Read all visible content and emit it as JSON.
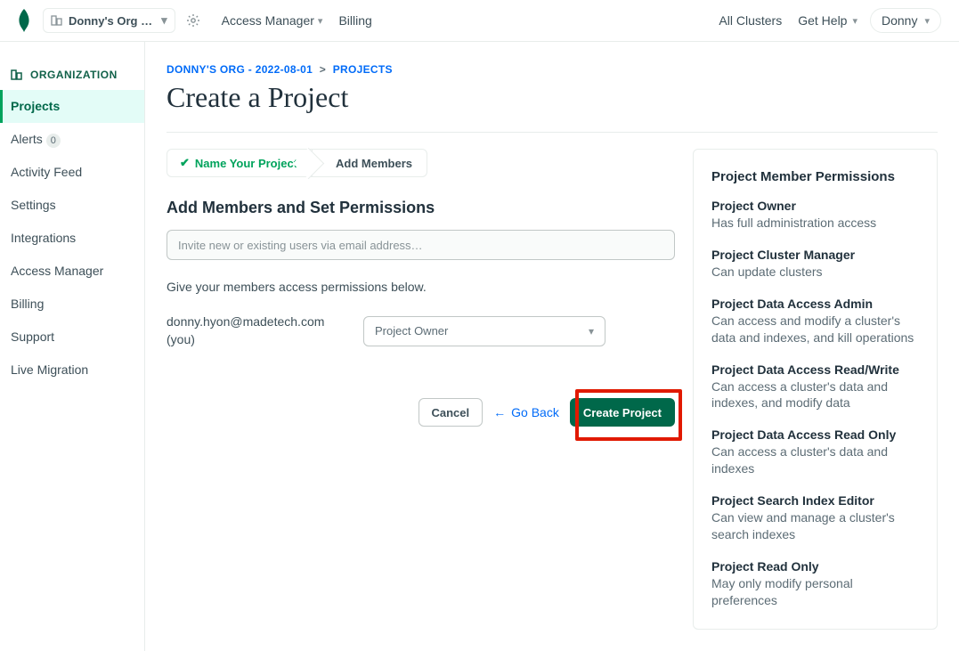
{
  "header": {
    "org_name": "Donny's Org …",
    "access_manager": "Access Manager",
    "billing": "Billing",
    "all_clusters": "All Clusters",
    "get_help": "Get Help",
    "user": "Donny"
  },
  "sidebar": {
    "heading": "ORGANIZATION",
    "items": [
      {
        "label": "Projects",
        "active": true
      },
      {
        "label": "Alerts",
        "badge": "0"
      },
      {
        "label": "Activity Feed"
      },
      {
        "label": "Settings"
      },
      {
        "label": "Integrations"
      },
      {
        "label": "Access Manager"
      },
      {
        "label": "Billing"
      },
      {
        "label": "Support"
      },
      {
        "label": "Live Migration"
      }
    ]
  },
  "breadcrumb": {
    "org": "DONNY'S ORG - 2022-08-01",
    "page": "PROJECTS"
  },
  "page_title": "Create a Project",
  "steps": {
    "step1": "Name Your Project",
    "step2": "Add Members"
  },
  "form": {
    "section_title": "Add Members and Set Permissions",
    "invite_placeholder": "Invite new or existing users via email address…",
    "hint": "Give your members access permissions below.",
    "member_email": "donny.hyon@madetech.com (you)",
    "role_selected": "Project Owner"
  },
  "actions": {
    "cancel": "Cancel",
    "go_back": "Go Back",
    "create": "Create Project"
  },
  "perm_panel": {
    "title": "Project Member Permissions",
    "items": [
      {
        "t": "Project Owner",
        "d": "Has full administration access"
      },
      {
        "t": "Project Cluster Manager",
        "d": "Can update clusters"
      },
      {
        "t": "Project Data Access Admin",
        "d": "Can access and modify a cluster's data and indexes, and kill operations"
      },
      {
        "t": "Project Data Access Read/Write",
        "d": "Can access a cluster's data and indexes, and modify data"
      },
      {
        "t": "Project Data Access Read Only",
        "d": "Can access a cluster's data and indexes"
      },
      {
        "t": "Project Search Index Editor",
        "d": "Can view and manage a cluster's search indexes"
      },
      {
        "t": "Project Read Only",
        "d": "May only modify personal preferences"
      }
    ]
  }
}
